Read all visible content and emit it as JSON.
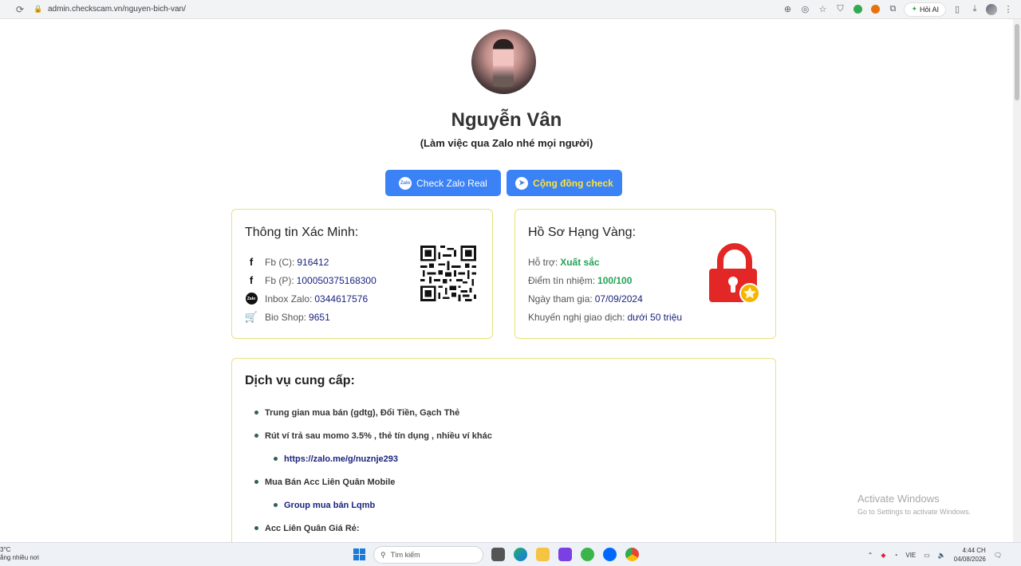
{
  "browser": {
    "url": "admin.checkscam.vn/nguyen-bich-van/",
    "ai_button_label": "Hỏi AI"
  },
  "profile": {
    "name": "Nguyễn Vân",
    "subtitle": "(Làm việc qua Zalo nhé mọi người)"
  },
  "buttons": {
    "zalo_label": "Check Zalo Real",
    "community_label": "Cộng đồng check"
  },
  "verify_card": {
    "title": "Thông tin Xác Minh:",
    "rows": [
      {
        "label": "Fb (C):",
        "value": "916412"
      },
      {
        "label": "Fb (P):",
        "value": "100050375168300"
      },
      {
        "label": "Inbox Zalo:",
        "value": "0344617576"
      },
      {
        "label": "Bio Shop:",
        "value": "9651"
      }
    ]
  },
  "gold_card": {
    "title": "Hồ Sơ Hạng Vàng:",
    "rows": [
      {
        "label": "Hỗ trợ:",
        "value": "Xuất sắc"
      },
      {
        "label": "Điểm tín nhiệm:",
        "value": "100/100"
      },
      {
        "label": "Ngày tham gia:",
        "value": "07/09/2024"
      },
      {
        "label": "Khuyến nghị giao dịch:",
        "value": "dưới 50 triệu"
      }
    ]
  },
  "services": {
    "title": "Dịch vụ cung cấp:",
    "items": [
      {
        "text": "Trung gian mua bán (gdtg), Đổi Tiền, Gạch Thẻ"
      },
      {
        "text": "Rút ví trả sau momo 3.5% , thẻ tín dụng , nhiều ví khác"
      },
      {
        "text": "https://zalo.me/g/nuznje293"
      },
      {
        "text": "Mua Bán Acc Liên Quân Mobile"
      },
      {
        "text": "Group mua bán Lqmb"
      },
      {
        "text": "Acc Liên Quân Giá Rẻ:"
      }
    ]
  },
  "watermark": {
    "line1": "Activate Windows",
    "line2": "Go to Settings to activate Windows."
  },
  "taskbar": {
    "weather_temp": "3°C",
    "weather_desc": "ắng nhiều nơi",
    "search_placeholder": "Tìm kiếm",
    "lang": "VIE",
    "time": "4:44 CH",
    "date": "04/08/2026"
  },
  "colors": {
    "accent_blue": "#3b82f6",
    "value_navy": "#1a237e",
    "value_green": "#22a355",
    "card_border": "#e9e27a",
    "highlight_yellow": "#ffe23a"
  },
  "icons": [
    "facebook-icon",
    "zalo-icon",
    "cart-icon",
    "telegram-icon",
    "qr-code",
    "gold-lock-icon"
  ]
}
